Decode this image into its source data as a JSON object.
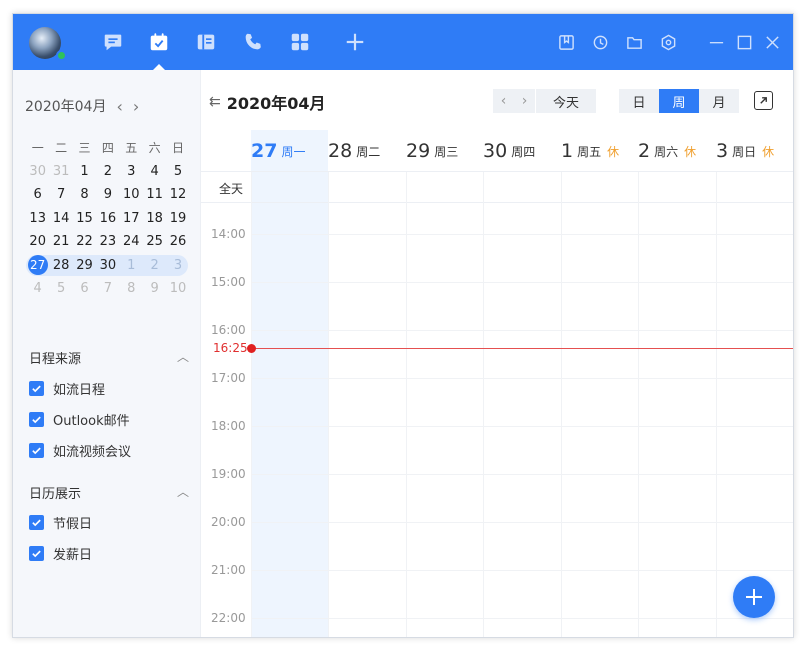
{
  "colors": {
    "accent": "#2f7cf6",
    "now": "#e02020",
    "rest": "#f0a030",
    "topbar": "#2f7cf6"
  },
  "topbar": {
    "nav_icons": [
      "chat-icon",
      "calendar-icon",
      "docs-icon",
      "phone-icon",
      "apps-icon",
      "add-icon"
    ],
    "active_nav": "calendar-icon",
    "tool_icons": [
      "bookmark-icon",
      "history-icon",
      "folder-icon",
      "settings-icon",
      "minimize-icon",
      "maximize-icon",
      "close-icon"
    ]
  },
  "sidebar": {
    "mini_title": "2020年04月",
    "prev_arrow": "‹",
    "next_arrow": "›",
    "weekdays": [
      "一",
      "二",
      "三",
      "四",
      "五",
      "六",
      "日"
    ],
    "weeks": [
      [
        "30",
        "31",
        "1",
        "2",
        "3",
        "4",
        "5"
      ],
      [
        "6",
        "7",
        "8",
        "9",
        "10",
        "11",
        "12"
      ],
      [
        "13",
        "14",
        "15",
        "16",
        "17",
        "18",
        "19"
      ],
      [
        "20",
        "21",
        "22",
        "23",
        "24",
        "25",
        "26"
      ],
      [
        "27",
        "28",
        "29",
        "30",
        "1",
        "2",
        "3"
      ],
      [
        "4",
        "5",
        "6",
        "7",
        "8",
        "9",
        "10"
      ]
    ],
    "sources_title": "日程来源",
    "sources": [
      "如流日程",
      "Outlook邮件",
      "如流视频会议"
    ],
    "display_title": "日历展示",
    "display": [
      "节假日",
      "发薪日"
    ]
  },
  "main": {
    "title": "2020年04月",
    "today_label": "今天",
    "prev": "‹",
    "next": "›",
    "views": [
      "日",
      "周",
      "月"
    ],
    "active_view": "周",
    "days": [
      {
        "num": "27",
        "week": "周一",
        "rest": ""
      },
      {
        "num": "28",
        "week": "周二",
        "rest": ""
      },
      {
        "num": "29",
        "week": "周三",
        "rest": ""
      },
      {
        "num": "30",
        "week": "周四",
        "rest": ""
      },
      {
        "num": "1",
        "week": "周五",
        "rest": "休"
      },
      {
        "num": "2",
        "week": "周六",
        "rest": "休"
      },
      {
        "num": "3",
        "week": "周日",
        "rest": "休"
      }
    ],
    "allday_label": "全天",
    "hours": [
      "14:00",
      "15:00",
      "16:00",
      "17:00",
      "18:00",
      "19:00",
      "20:00",
      "21:00",
      "22:00"
    ],
    "now_time": "16:25"
  }
}
